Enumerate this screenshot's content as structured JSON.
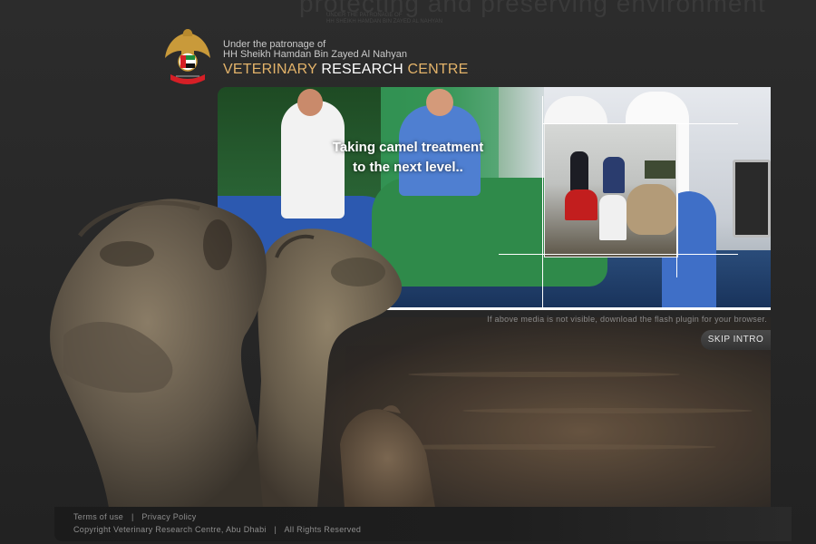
{
  "top_slogan": "protecting and preserving environment",
  "top_slogan_sub": [
    "UNDER THE PATRONAGE OF",
    "HH SHEIKH HAMDAN BIN ZAYED AL NAHYAN"
  ],
  "header": {
    "patronage_line1": "Under the patronage of",
    "patronage_line2": "HH Sheikh Hamdan Bin Zayed Al Nahyan",
    "centre_name_parts": [
      "VETERINARY",
      "RESEARCH",
      "CENTRE"
    ]
  },
  "banner": {
    "caption_line1": "Taking camel treatment",
    "caption_line2": "to the next level.."
  },
  "flash_note": "If above media is not visible, download the flash plugin for your browser.",
  "skip_intro_label": "SKIP INTRO",
  "footer": {
    "links": [
      "Terms of use",
      "Privacy Policy"
    ],
    "separator": "|",
    "copyright_parts": [
      "Copyright Veterinary Research Centre, Abu Dhabi",
      "All Rights Reserved"
    ]
  },
  "colors": {
    "accent_gold": "#e3b36a",
    "background": "#2a2a2a",
    "footer_text": "#8e8e8e"
  },
  "icons": [
    "uae-emblem-icon"
  ]
}
